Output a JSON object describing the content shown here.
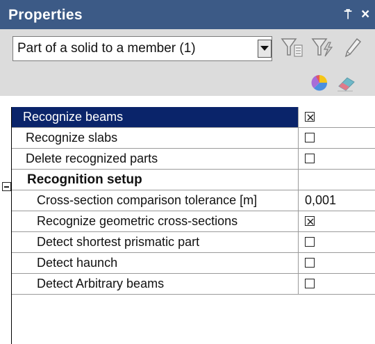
{
  "panel": {
    "title": "Properties",
    "pin_glyph": "⍑",
    "close_glyph": "×"
  },
  "toolbar": {
    "selector_value": "Part of a solid to a member (1)",
    "icons": [
      "filter-icon",
      "filter-lightning-icon",
      "pencil-icon",
      "pie-chart-icon",
      "eraser-icon"
    ]
  },
  "rows": [
    {
      "label": "Recognize beams",
      "type": "checkbox",
      "checked": true,
      "selected": true
    },
    {
      "label": "Recognize slabs",
      "type": "checkbox",
      "checked": false
    },
    {
      "label": "Delete recognized parts",
      "type": "checkbox",
      "checked": false
    },
    {
      "label": "Recognition setup",
      "type": "category",
      "expanded": true
    },
    {
      "label": "Cross-section comparison tolerance [m]",
      "type": "text",
      "value": "0,001"
    },
    {
      "label": "Recognize geometric cross-sections",
      "type": "checkbox",
      "checked": true
    },
    {
      "label": "Detect shortest prismatic part",
      "type": "checkbox",
      "checked": false
    },
    {
      "label": "Detect haunch",
      "type": "checkbox",
      "checked": false
    },
    {
      "label": "Detect Arbitrary beams",
      "type": "checkbox",
      "checked": false
    }
  ],
  "colors": {
    "title_bar": "#3c5a86",
    "selected_row": "#0a246a",
    "toolbar_bg": "#dcdcdc"
  }
}
